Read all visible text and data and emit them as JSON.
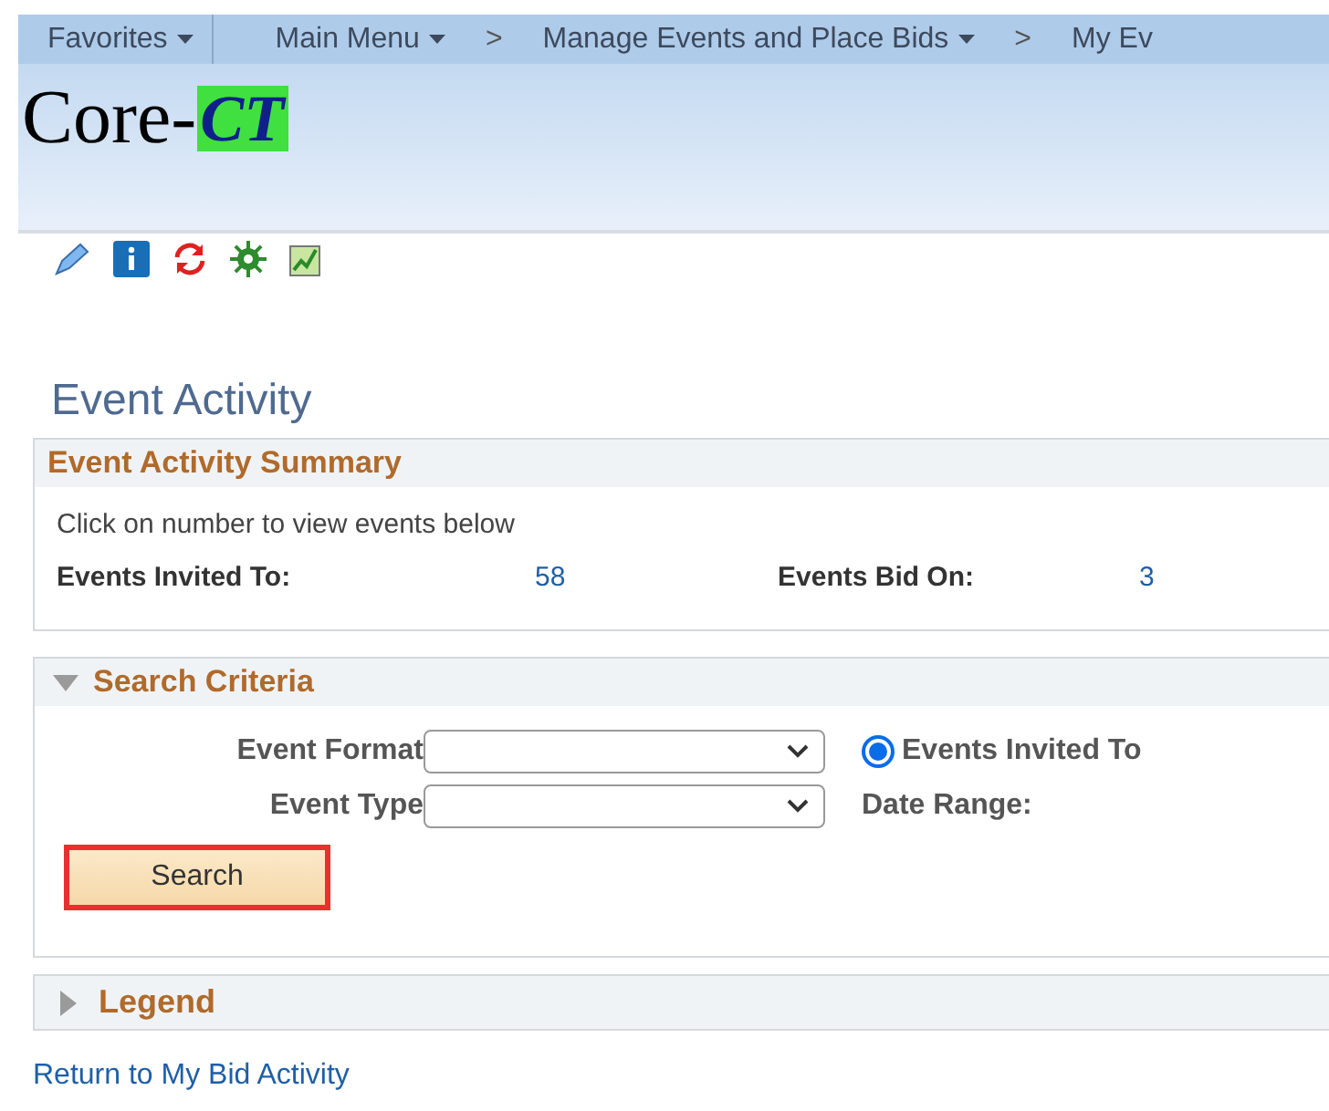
{
  "nav": [
    {
      "label": "Favorites",
      "dropdown": true
    },
    {
      "label": "Main Menu",
      "dropdown": true
    },
    {
      "separator": ">",
      "label": "Manage Events and Place Bids",
      "dropdown": true
    },
    {
      "separator": ">",
      "label": "My Ev",
      "dropdown": false
    }
  ],
  "logo": {
    "text": "Core-",
    "mark": "CT"
  },
  "page_title": "Event Activity",
  "summary": {
    "title": "Event Activity Summary",
    "hint": "Click on number to view events below",
    "stats": [
      {
        "label": "Events Invited To:",
        "value": "58"
      },
      {
        "label": "Events Bid On:",
        "value": "3"
      }
    ]
  },
  "search_criteria": {
    "title": "Search Criteria",
    "expanded": true,
    "fields": [
      {
        "label": "Event Format"
      },
      {
        "label": "Event Type"
      }
    ],
    "radio": {
      "label": "Events Invited To",
      "selected": true
    },
    "date_range_label": "Date Range:",
    "button": "Search"
  },
  "legend": {
    "title": "Legend",
    "expanded": false
  },
  "return_link": "Return to My Bid Activity"
}
